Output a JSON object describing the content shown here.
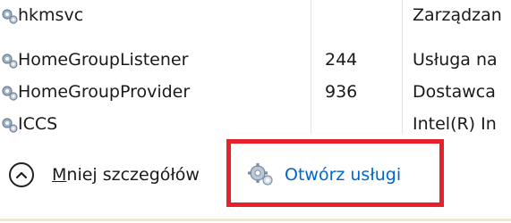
{
  "services": [
    {
      "name": "hkmsvc",
      "pid": "",
      "description": "Zarządzan"
    },
    {
      "name": "HomeGroupListener",
      "pid": "244",
      "description": "Usługa na"
    },
    {
      "name": "HomeGroupProvider",
      "pid": "936",
      "description": "Dostawca"
    },
    {
      "name": "ICCS",
      "pid": "",
      "description": "Intel(R) In"
    }
  ],
  "footer": {
    "fewer_details_accel": "M",
    "fewer_details_rest": "niej szczegółów",
    "open_services_label": "Otwórz usługi"
  },
  "colors": {
    "link": "#0066cc",
    "highlight": "#e8202a"
  },
  "icons": {
    "service_icon": "gears-service-icon",
    "collapse_icon": "chevron-up-icon",
    "open_services_icon": "gear-icon"
  }
}
